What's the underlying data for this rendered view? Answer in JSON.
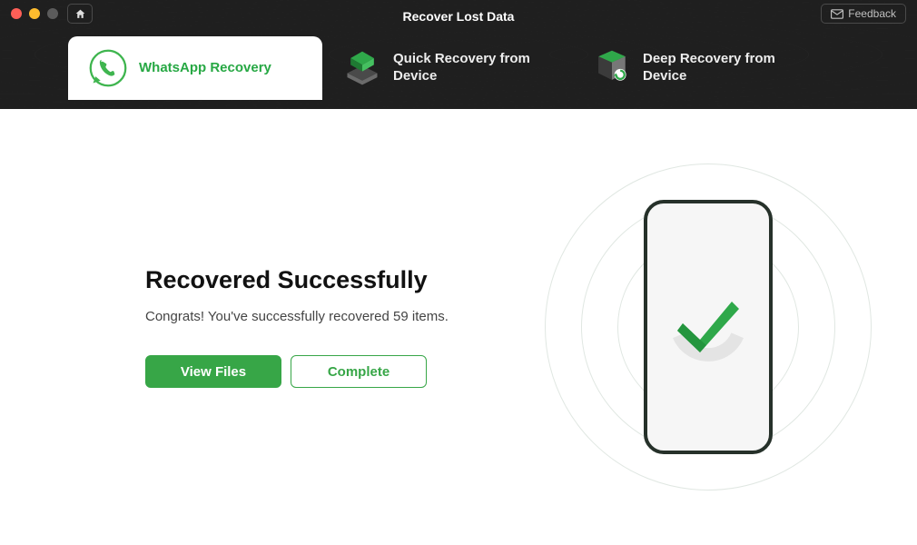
{
  "window": {
    "title": "Recover Lost Data",
    "feedback_label": "Feedback"
  },
  "tabs": {
    "whatsapp": {
      "label": "WhatsApp Recovery"
    },
    "quick": {
      "label": "Quick Recovery from Device"
    },
    "deep": {
      "label": "Deep Recovery from Device"
    }
  },
  "main": {
    "heading": "Recovered Successfully",
    "subtext": "Congrats! You've successfully recovered 59 items.",
    "recovered_count": 59,
    "view_files_label": "View Files",
    "complete_label": "Complete"
  },
  "colors": {
    "accent": "#37a647",
    "dark": "#1f1f1f"
  }
}
